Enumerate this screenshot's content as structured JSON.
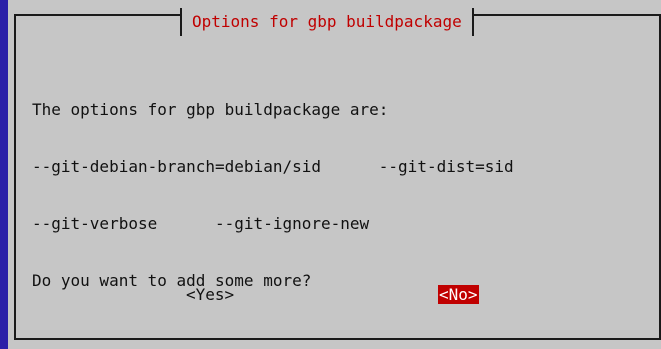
{
  "dialog": {
    "title": "Options for gbp buildpackage",
    "lines": [
      "The options for gbp buildpackage are:",
      "--git-debian-branch=debian/sid      --git-dist=sid",
      "--git-verbose      --git-ignore-new",
      "Do you want to add some more?"
    ],
    "buttons": {
      "yes_label": "<Yes>",
      "no_label": "<No>"
    },
    "selected_button": "no"
  },
  "colors": {
    "background": "#2b1fa8",
    "dialog": "#c6c6c6",
    "title": "#c00000",
    "selected_button_bg": "#c00000"
  }
}
